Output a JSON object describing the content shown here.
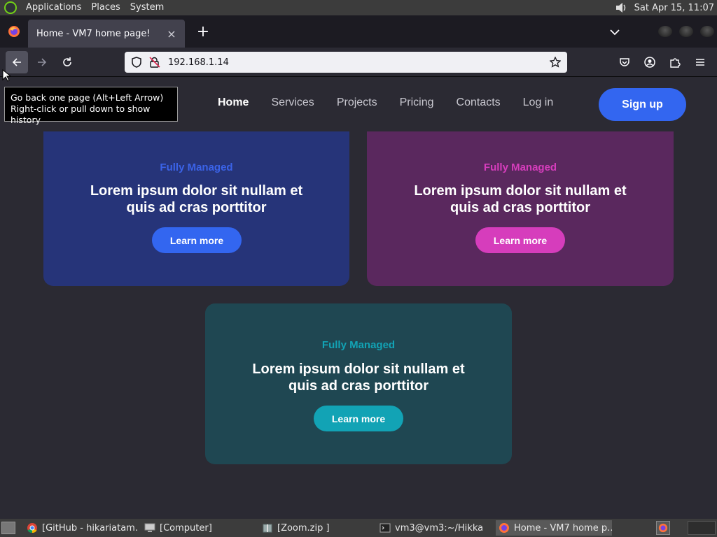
{
  "top_panel": {
    "menu": [
      "Applications",
      "Places",
      "System"
    ],
    "clock": "Sat Apr 15, 11:07",
    "icons": [
      "gnome-logo-icon",
      "volume-icon"
    ]
  },
  "browser": {
    "tab_title": "Home - VM7 home page!",
    "url": "192.168.1.14",
    "tooltip_line1": "Go back one page (Alt+Left Arrow)",
    "tooltip_line2": "Right-click or pull down to show history",
    "toolbar_icons": [
      "back-arrow-icon",
      "forward-arrow-icon",
      "reload-icon",
      "shield-icon",
      "lock-warning-icon",
      "bookmark-star-icon",
      "pocket-icon",
      "account-icon",
      "extensions-icon",
      "menu-icon"
    ]
  },
  "site": {
    "nav": [
      "Home",
      "Services",
      "Projects",
      "Pricing",
      "Contacts",
      "Log in"
    ],
    "signup": "Sign up",
    "cards": [
      {
        "eyebrow": "Fully Managed",
        "heading_line1": "Lorem ipsum dolor sit nullam et",
        "heading_line2": "quis ad cras porttitor",
        "button": "Learn more",
        "accent": "#3366f0"
      },
      {
        "eyebrow": "Fully Managed",
        "heading_line1": "Lorem ipsum dolor sit nullam et",
        "heading_line2": "quis ad cras porttitor",
        "button": "Learn more",
        "accent": "#d63dbc"
      },
      {
        "eyebrow": "Fully Managed",
        "heading_line1": "Lorem ipsum dolor sit nullam et",
        "heading_line2": "quis ad cras porttitor",
        "button": "Learn more",
        "accent": "#12a3b5"
      }
    ]
  },
  "taskbar": {
    "items": [
      "[GitHub - hikariatam…",
      "[Computer]",
      "[Zoom.zip ]",
      "vm3@vm3:~/Hikka",
      "Home - VM7 home p…"
    ]
  }
}
